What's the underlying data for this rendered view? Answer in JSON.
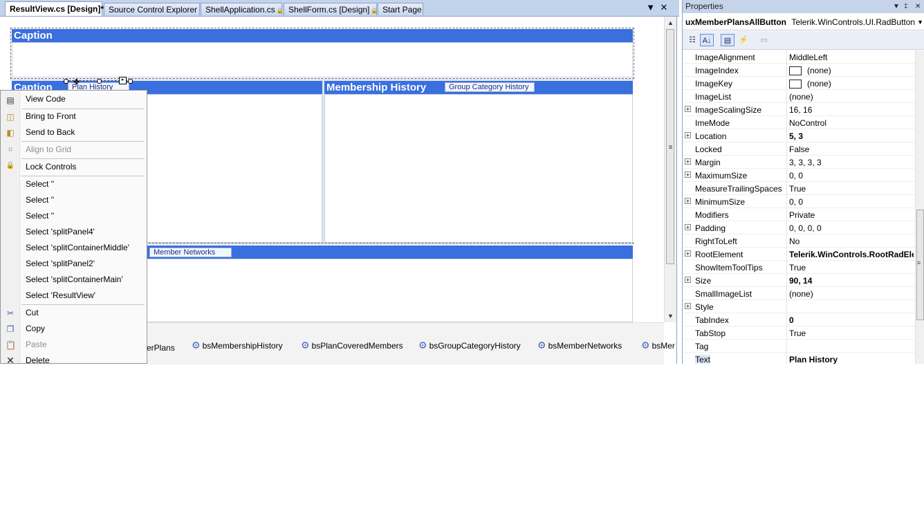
{
  "tabs": [
    {
      "label": "ResultView.cs [Design]*",
      "active": true,
      "locked": false
    },
    {
      "label": "Source Control Explorer",
      "active": false,
      "locked": false
    },
    {
      "label": "ShellApplication.cs",
      "active": false,
      "locked": true
    },
    {
      "label": "ShellForm.cs [Design]",
      "active": false,
      "locked": true
    },
    {
      "label": "Start Page",
      "active": false,
      "locked": false
    }
  ],
  "tab_buttons": {
    "dropdown": "▼",
    "close": "✕"
  },
  "designer": {
    "top_caption": "Caption",
    "left_caption": "Caption",
    "plan_history_button": "Plan History",
    "membership_caption": "Membership History",
    "group_category_button": "Group Category History",
    "member_networks_button": "Member Networks",
    "tray_items": [
      "erPlans",
      "bsMembershipHistory",
      "bsPlanCoveredMembers",
      "bsGroupCategoryHistory",
      "bsMemberNetworks",
      "bsMer"
    ]
  },
  "context_menu": {
    "items": [
      {
        "label": "View Code",
        "icon": "view-code-icon",
        "disabled": false
      },
      {
        "label": "Bring to Front",
        "icon": "bring-to-front-icon",
        "disabled": false
      },
      {
        "label": "Send to Back",
        "icon": "send-to-back-icon",
        "disabled": false
      },
      {
        "label": "Align to Grid",
        "icon": "align-to-grid-icon",
        "disabled": true
      },
      {
        "label": "Lock Controls",
        "icon": "lock-icon",
        "disabled": false
      },
      {
        "label": "Select ''",
        "icon": "",
        "disabled": false
      },
      {
        "label": "Select ''",
        "icon": "",
        "disabled": false
      },
      {
        "label": "Select ''",
        "icon": "",
        "disabled": false
      },
      {
        "label": "Select 'splitPanel4'",
        "icon": "",
        "disabled": false
      },
      {
        "label": "Select 'splitContainerMiddle'",
        "icon": "",
        "disabled": false
      },
      {
        "label": "Select 'splitPanel2'",
        "icon": "",
        "disabled": false
      },
      {
        "label": "Select 'splitContainerMain'",
        "icon": "",
        "disabled": false
      },
      {
        "label": "Select 'ResultView'",
        "icon": "",
        "disabled": false
      },
      {
        "label": "Cut",
        "icon": "cut-icon",
        "disabled": false
      },
      {
        "label": "Copy",
        "icon": "copy-icon",
        "disabled": false
      },
      {
        "label": "Paste",
        "icon": "paste-icon",
        "disabled": true
      },
      {
        "label": "Delete",
        "icon": "delete-icon",
        "disabled": false
      }
    ]
  },
  "properties": {
    "title": "Properties",
    "title_buttons": {
      "dropdown": "▼",
      "pin": "‡",
      "close": "✕"
    },
    "object_name": "uxMemberPlansAllButton",
    "object_type": "Telerik.WinControls.UI.RadButton",
    "rows": [
      {
        "name": "ImageAlignment",
        "value": "MiddleLeft",
        "expandable": false,
        "bold": false,
        "swatch": false
      },
      {
        "name": "ImageIndex",
        "value": "(none)",
        "expandable": false,
        "bold": false,
        "swatch": true
      },
      {
        "name": "ImageKey",
        "value": "(none)",
        "expandable": false,
        "bold": false,
        "swatch": true
      },
      {
        "name": "ImageList",
        "value": "(none)",
        "expandable": false,
        "bold": false,
        "swatch": false
      },
      {
        "name": "ImageScalingSize",
        "value": "16, 16",
        "expandable": true,
        "bold": false,
        "swatch": false
      },
      {
        "name": "ImeMode",
        "value": "NoControl",
        "expandable": false,
        "bold": false,
        "swatch": false
      },
      {
        "name": "Location",
        "value": "5, 3",
        "expandable": true,
        "bold": true,
        "swatch": false
      },
      {
        "name": "Locked",
        "value": "False",
        "expandable": false,
        "bold": false,
        "swatch": false
      },
      {
        "name": "Margin",
        "value": "3, 3, 3, 3",
        "expandable": true,
        "bold": false,
        "swatch": false
      },
      {
        "name": "MaximumSize",
        "value": "0, 0",
        "expandable": true,
        "bold": false,
        "swatch": false
      },
      {
        "name": "MeasureTrailingSpaces",
        "value": "True",
        "expandable": false,
        "bold": false,
        "swatch": false
      },
      {
        "name": "MinimumSize",
        "value": "0, 0",
        "expandable": true,
        "bold": false,
        "swatch": false
      },
      {
        "name": "Modifiers",
        "value": "Private",
        "expandable": false,
        "bold": false,
        "swatch": false
      },
      {
        "name": "Padding",
        "value": "0, 0, 0, 0",
        "expandable": true,
        "bold": false,
        "swatch": false
      },
      {
        "name": "RightToLeft",
        "value": "No",
        "expandable": false,
        "bold": false,
        "swatch": false
      },
      {
        "name": "RootElement",
        "value": "Telerik.WinControls.RootRadElement",
        "expandable": true,
        "bold": true,
        "swatch": false
      },
      {
        "name": "ShowItemToolTips",
        "value": "True",
        "expandable": false,
        "bold": false,
        "swatch": false
      },
      {
        "name": "Size",
        "value": "90, 14",
        "expandable": true,
        "bold": true,
        "swatch": false
      },
      {
        "name": "SmallImageList",
        "value": "(none)",
        "expandable": false,
        "bold": false,
        "swatch": false
      },
      {
        "name": "Style",
        "value": "",
        "expandable": true,
        "bold": false,
        "swatch": false
      },
      {
        "name": "TabIndex",
        "value": "0",
        "expandable": false,
        "bold": true,
        "swatch": false
      },
      {
        "name": "TabStop",
        "value": "True",
        "expandable": false,
        "bold": false,
        "swatch": false
      },
      {
        "name": "Tag",
        "value": "",
        "expandable": false,
        "bold": false,
        "swatch": false
      },
      {
        "name": "Text",
        "value": "Plan History",
        "expandable": false,
        "bold": true,
        "swatch": false,
        "selected": true
      }
    ]
  },
  "colors": {
    "caption_bar": "#3a6fde",
    "tab_strip": "#c2d3ec"
  }
}
